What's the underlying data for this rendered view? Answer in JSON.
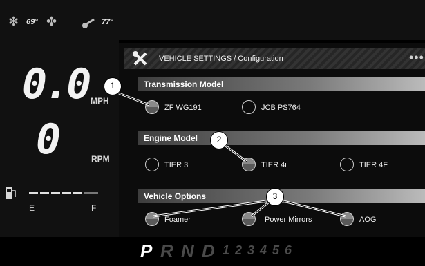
{
  "status": {
    "outside_temp": "69°",
    "coolant_temp": "77°",
    "icons": [
      "snowflake-icon",
      "fan-icon",
      "thermometer-icon"
    ]
  },
  "cluster": {
    "speed": "0.0",
    "speed_unit": "MPH",
    "rpm": "0",
    "rpm_unit": "RPM",
    "fuel_empty": "E",
    "fuel_full": "F"
  },
  "header": {
    "title": "VEHICLE SETTINGS / Configuration",
    "menu_icon": "more-dots-icon",
    "tool_icon": "wrench-screwdriver-icon"
  },
  "sections": [
    {
      "title": "Transmission Model",
      "options": [
        {
          "label": "ZF WG191",
          "selected": true
        },
        {
          "label": "JCB PS764",
          "selected": false
        }
      ]
    },
    {
      "title": "Engine Model",
      "options": [
        {
          "label": "TIER 3",
          "selected": false
        },
        {
          "label": "TIER 4i",
          "selected": true
        },
        {
          "label": "TIER 4F",
          "selected": false
        }
      ]
    },
    {
      "title": "Vehicle Options",
      "options": [
        {
          "label": "Foamer",
          "selected": true
        },
        {
          "label": "Power Mirrors",
          "selected": true
        },
        {
          "label": "AOG",
          "selected": true
        }
      ]
    }
  ],
  "gears": [
    "P",
    "R",
    "N",
    "D",
    "1",
    "2",
    "3",
    "4",
    "5",
    "6"
  ],
  "active_gear": "P",
  "callouts": [
    "1",
    "2",
    "3"
  ],
  "colors": {
    "background": "#000000",
    "panel": "#0c0c0c",
    "text": "#f0f0f0",
    "active_gear": "#ffffff",
    "inactive_gear": "#4a4a4a"
  }
}
